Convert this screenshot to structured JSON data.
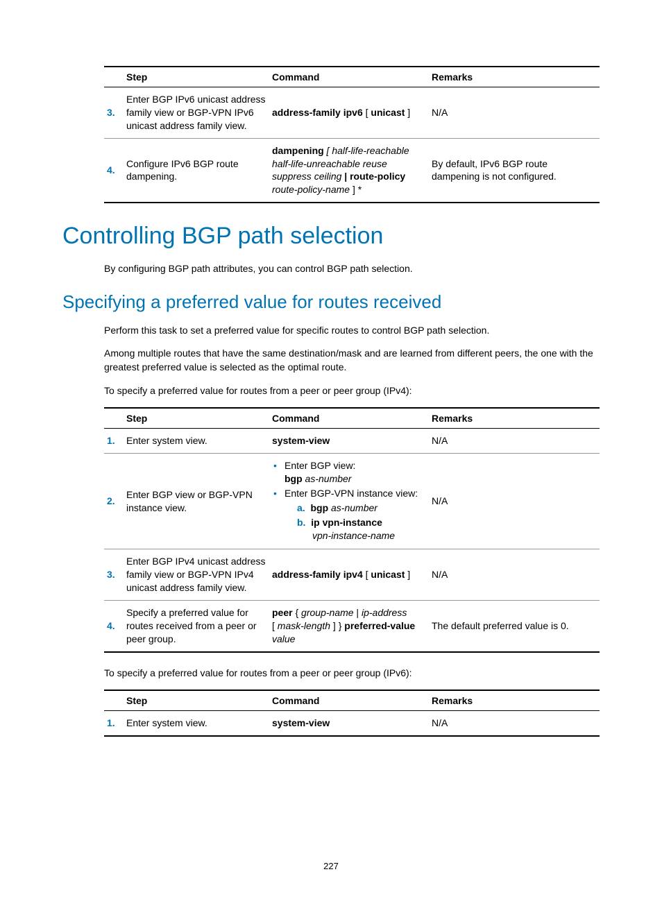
{
  "table1": {
    "headers": [
      "Step",
      "Command",
      "Remarks"
    ],
    "rows": [
      {
        "num": "3.",
        "step": "Enter BGP IPv6 unicast address family view or BGP-VPN IPv6 unicast address family view.",
        "cmd_bold": "address-family ipv6",
        "cmd_bracket": " [ ",
        "cmd_bold2": "unicast",
        "cmd_bracket2": " ]",
        "remarks": "N/A"
      },
      {
        "num": "4.",
        "step": "Configure IPv6 BGP route dampening.",
        "cmd": {
          "b1": "dampening",
          "i1": " [ half-life-reachable half-life-unreachable reuse suppress ceiling ",
          "b2": "| route-policy",
          "i2": " route-policy-name",
          "t1": " ] *"
        },
        "remarks": "By default, IPv6 BGP route dampening is not configured."
      }
    ]
  },
  "h1": "Controlling BGP path selection",
  "p1": "By configuring BGP path attributes, you can control BGP path selection.",
  "h2": "Specifying a preferred value for routes received",
  "p2": "Perform this task to set a preferred value for specific routes to control BGP path selection.",
  "p3": "Among multiple routes that have the same destination/mask and are learned from different peers, the one with the greatest preferred value is selected as the optimal route.",
  "p4": "To specify a preferred value for routes from a peer or peer group (IPv4):",
  "table2": {
    "headers": [
      "Step",
      "Command",
      "Remarks"
    ],
    "rows": [
      {
        "num": "1.",
        "step": "Enter system view.",
        "cmd": "system-view",
        "remarks": "N/A"
      },
      {
        "num": "2.",
        "step": "Enter BGP view or BGP-VPN instance view.",
        "bullet1_text": "Enter BGP view:",
        "bullet1_b": "bgp",
        "bullet1_i": " as-number",
        "bullet2_text": "Enter BGP-VPN instance view:",
        "sub_a_b": "bgp",
        "sub_a_i": " as-number",
        "sub_b_b": "ip vpn-instance",
        "sub_b_i": "vpn-instance-name",
        "remarks": "N/A"
      },
      {
        "num": "3.",
        "step": "Enter BGP IPv4 unicast address family view or BGP-VPN IPv4 unicast address family view.",
        "cmd_bold": "address-family ipv4",
        "cmd_bracket": " [ ",
        "cmd_bold2": "unicast",
        "cmd_bracket2": " ]",
        "remarks": "N/A"
      },
      {
        "num": "4.",
        "step": "Specify a preferred value for routes received from a peer or peer group.",
        "cmd": {
          "b1": "peer",
          "t1": " { ",
          "i1": "group-name",
          "t2": " | ",
          "i2": "ip-address",
          "t3": " [ ",
          "i3": "mask-length",
          "t4": " ] } ",
          "b2": "preferred-value",
          "i4": " value"
        },
        "remarks": "The default preferred value is 0."
      }
    ]
  },
  "p5": "To specify a preferred value for routes from a peer or peer group (IPv6):",
  "table3": {
    "headers": [
      "Step",
      "Command",
      "Remarks"
    ],
    "rows": [
      {
        "num": "1.",
        "step": "Enter system view.",
        "cmd": "system-view",
        "remarks": "N/A"
      }
    ]
  },
  "page_number": "227"
}
